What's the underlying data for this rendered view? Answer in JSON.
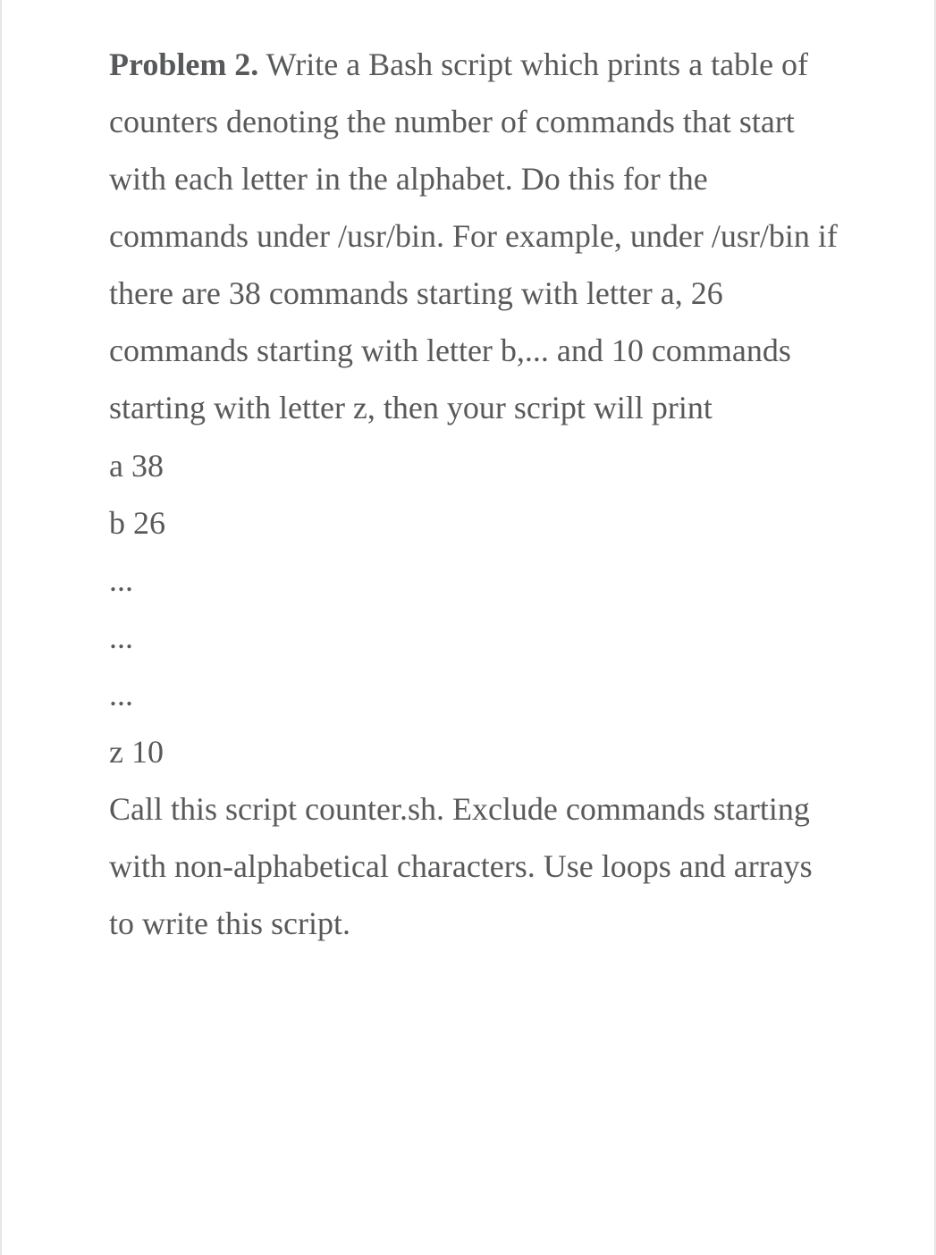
{
  "problem": {
    "label": "Problem 2.",
    "body_text": " Write a Bash script which prints a table of counters denoting the number of commands that start with each letter in the alphabet. Do this for the commands under /usr/bin. For example, under /usr/bin if there are 38 commands starting with letter a, 26 commands starting with letter b,... and 10 commands starting with letter z, then your script will print",
    "output_lines": [
      " a 38",
      "b 26",
      "...",
      "...",
      "...",
      "z 10"
    ],
    "tail_text": " Call this script counter.sh. Exclude commands starting with non-alphabetical characters. Use loops and arrays to write this script."
  }
}
